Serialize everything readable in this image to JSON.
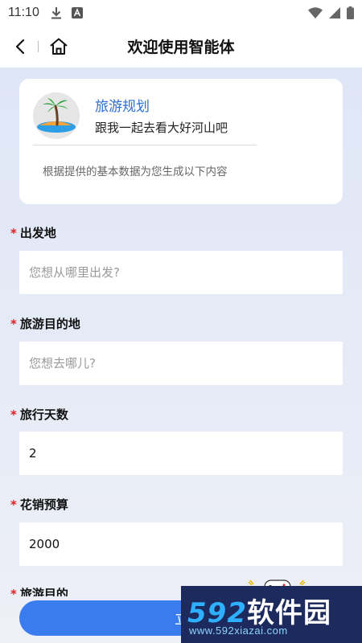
{
  "status_bar": {
    "time": "11:10",
    "icons_left": [
      "download-icon",
      "a-app-icon"
    ],
    "icons_right": [
      "wifi-icon",
      "signal-icon",
      "battery-icon"
    ]
  },
  "nav": {
    "title": "欢迎使用智能体",
    "back_icon": "back-arrow-icon",
    "home_icon": "home-icon"
  },
  "agent": {
    "name": "旅游规划",
    "description": "跟我一起去看大好河山吧",
    "note": "根据提供的基本数据为您生成以下内容",
    "avatar_icon": "palm-island-icon"
  },
  "form": {
    "required_mark": "*",
    "fields": [
      {
        "label": "出发地",
        "value": "",
        "placeholder": "您想从哪里出发?"
      },
      {
        "label": "旅游目的地",
        "value": "",
        "placeholder": "您想去哪儿?"
      },
      {
        "label": "旅行天数",
        "value": "2",
        "placeholder": ""
      },
      {
        "label": "花销预算",
        "value": "2000",
        "placeholder": ""
      },
      {
        "label": "旅游目的",
        "value": "",
        "placeholder": ""
      }
    ]
  },
  "submit": {
    "label": "立即"
  },
  "watermark": {
    "num": "592",
    "text": "软件园",
    "url": "www.592xiazai.com"
  },
  "colors": {
    "accent": "#3a7bf0",
    "agent_name": "#2d6fd1",
    "required": "#e02020",
    "background_top": "#dfe6f6",
    "watermark_bg": "#1c2a5e"
  }
}
